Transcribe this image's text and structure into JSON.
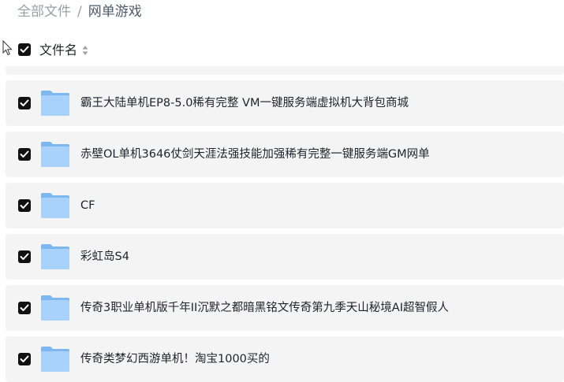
{
  "breadcrumb": {
    "root": "全部文件",
    "separator": "/",
    "current": "网单游戏"
  },
  "header": {
    "name_column": "文件名",
    "all_selected": true
  },
  "files": [
    {
      "name": "霸王大陆单机EP8-5.0稀有完整 VM一键服务端虚拟机大背包商城",
      "selected": true,
      "icon": "folder-icon"
    },
    {
      "name": "赤壁OL单机3646仗剑天涯法强技能加强稀有完整一键服务端GM网单",
      "selected": true,
      "icon": "folder-icon"
    },
    {
      "name": "CF",
      "selected": true,
      "icon": "folder-icon"
    },
    {
      "name": "彩虹岛S4",
      "selected": true,
      "icon": "folder-icon"
    },
    {
      "name": "传奇3职业单机版千年II沉默之都暗黑铭文传奇第九季天山秘境AI超智假人",
      "selected": true,
      "icon": "folder-icon"
    },
    {
      "name": "传奇类梦幻西游单机！淘宝1000买的",
      "selected": true,
      "icon": "folder-icon"
    }
  ],
  "colors": {
    "row_background": "#f4f4f5",
    "checkbox": "#111111",
    "folder_back": "#7db7f0",
    "folder_front": "#a9d2fb"
  }
}
